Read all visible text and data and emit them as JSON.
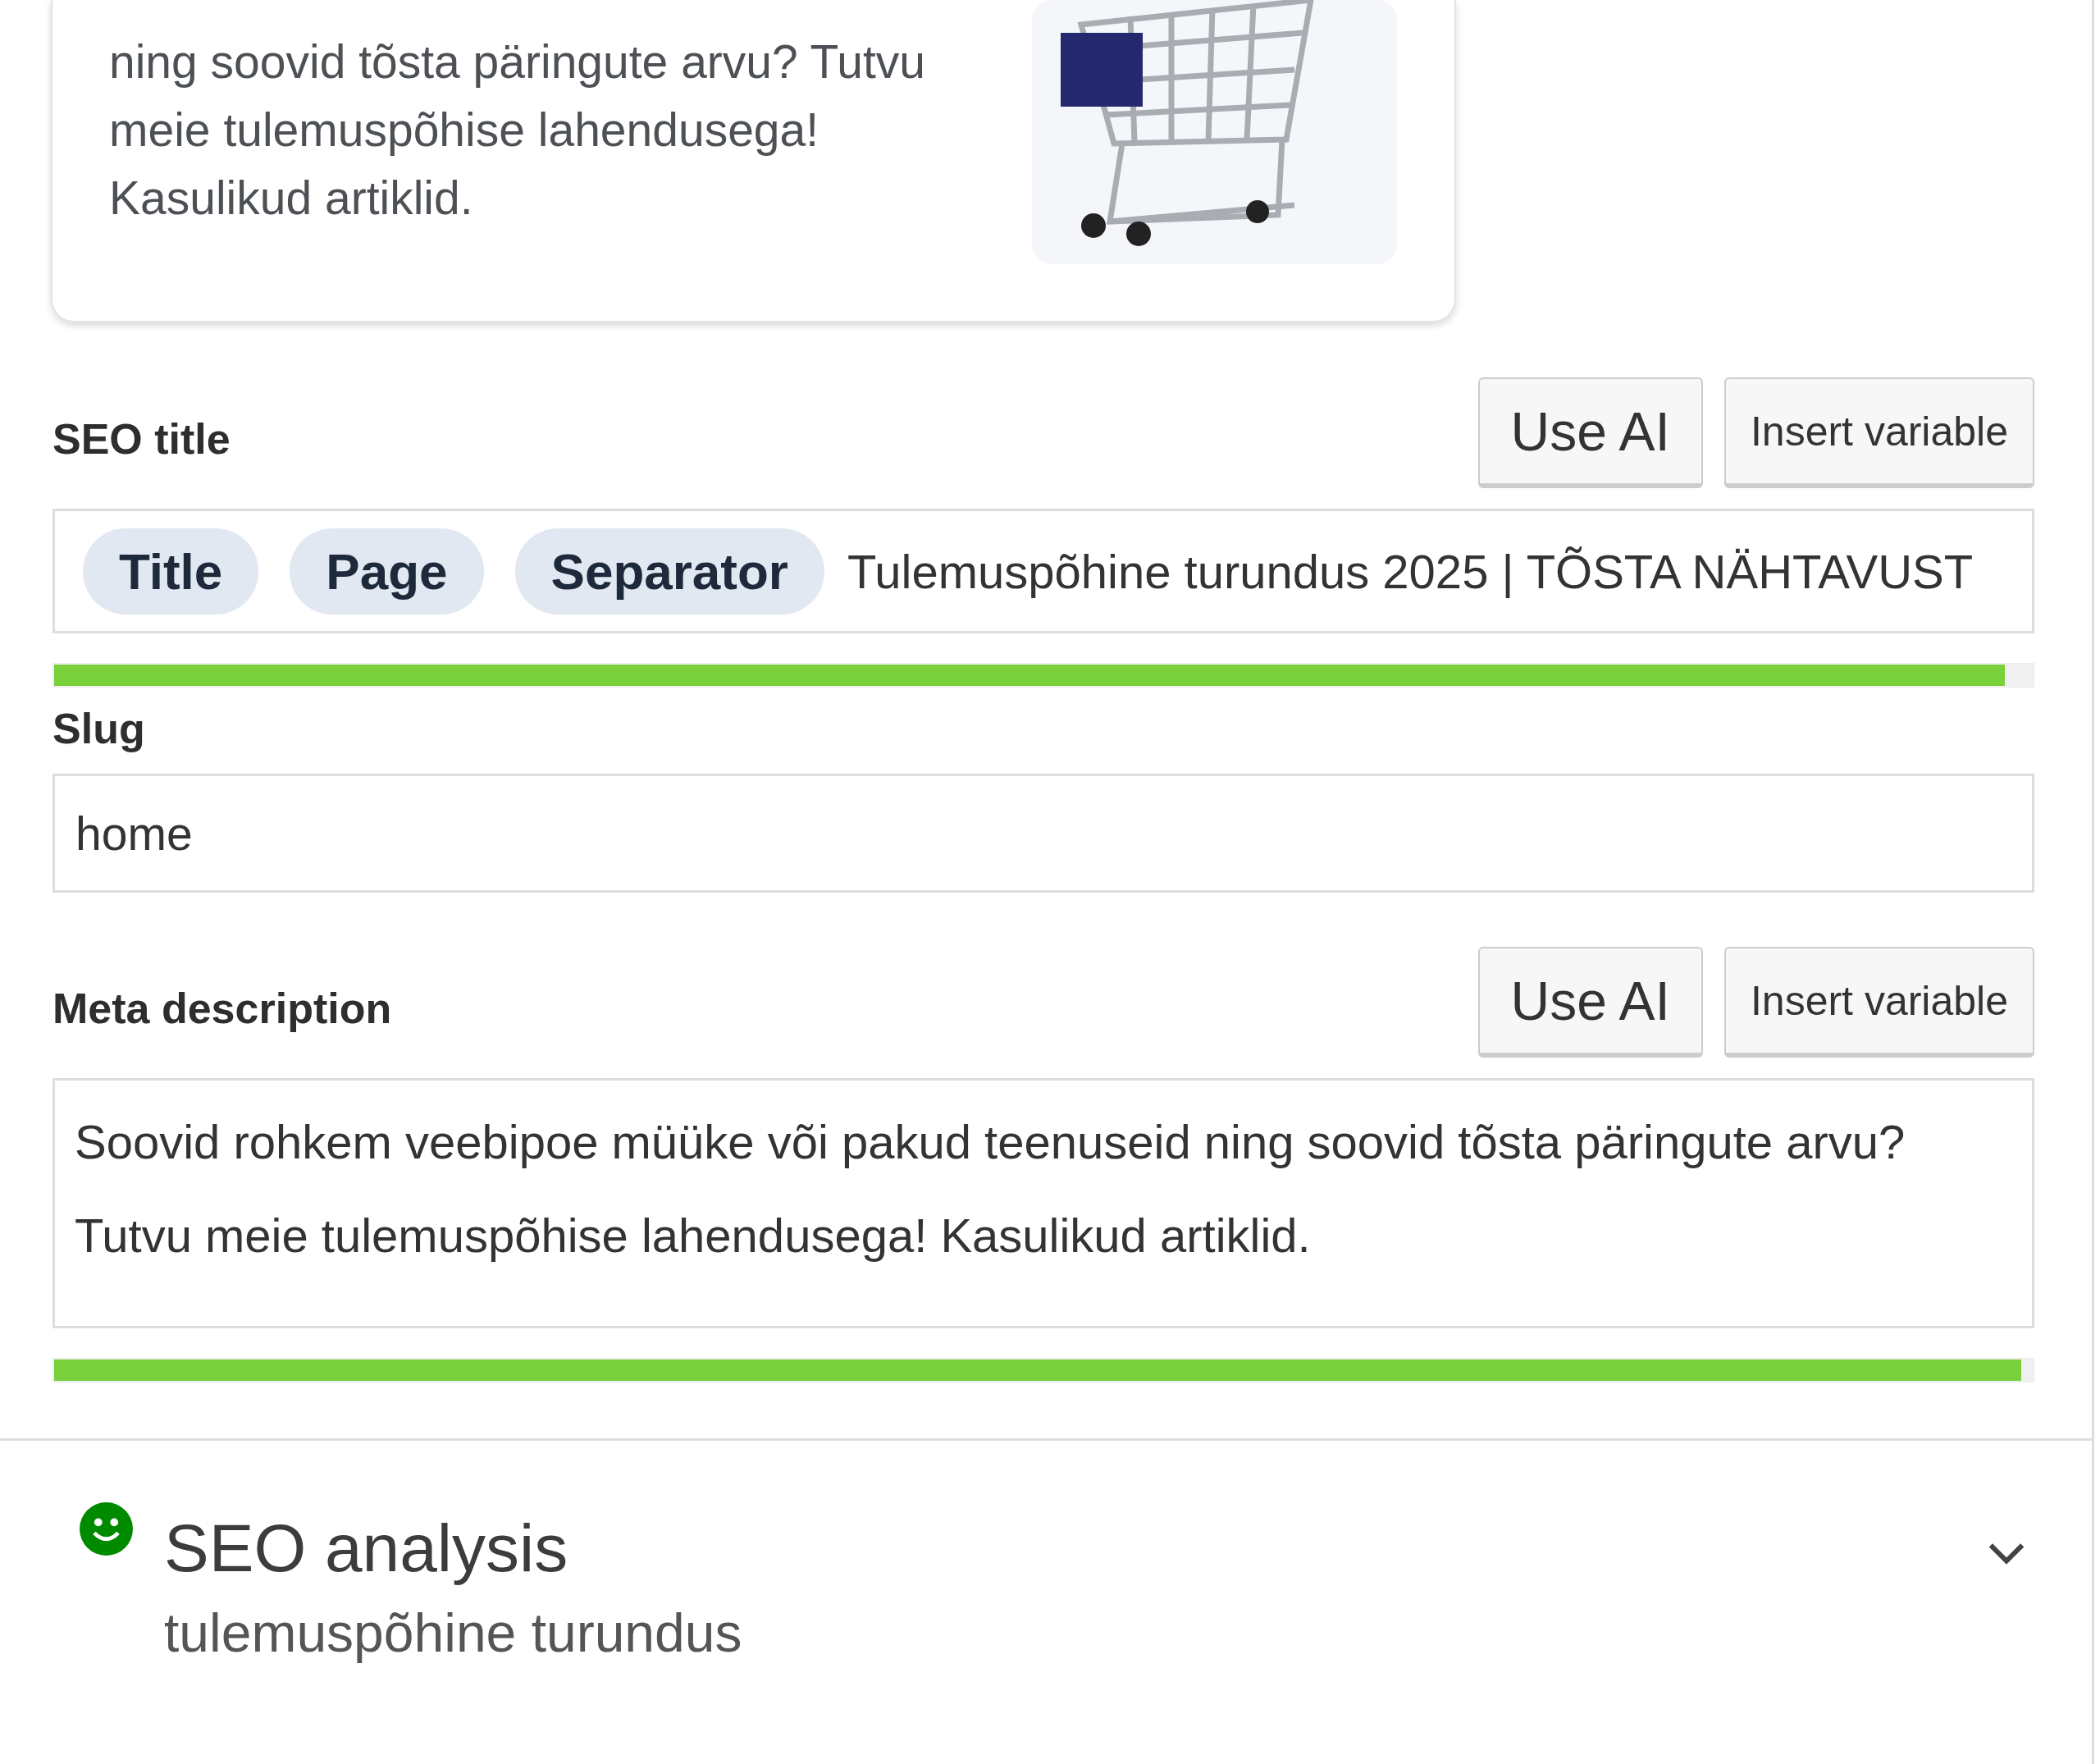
{
  "snippet_preview": {
    "description": "ning soovid tõsta päringute arvu? Tutvu meie tulemuspõhise lahendusega! Kasulikud artiklid."
  },
  "seo_title": {
    "label": "SEO title",
    "buttons": [
      "Use AI",
      "Insert variable"
    ],
    "variables": [
      "Title",
      "Page",
      "Separator"
    ],
    "value": "Tulemuspõhine turundus 2025 | TÕSTA NÄHTAVUST",
    "level": 0.986
  },
  "slug": {
    "label": "Slug",
    "value": "home"
  },
  "meta_description": {
    "label": "Meta description",
    "buttons": [
      "Use AI",
      "Insert variable"
    ],
    "value": "Soovid rohkem veebipoe müüke või pakud teenuseid ning soovid tõsta päringute arvu? Tutvu meie tulemuspõhise lahendusega! Kasulikud artiklid.",
    "level": 0.994
  },
  "seo_analysis": {
    "title": "SEO analysis",
    "keyphrase": "tulemuspõhine turundus",
    "color": "#008a00",
    "expanded": false
  }
}
